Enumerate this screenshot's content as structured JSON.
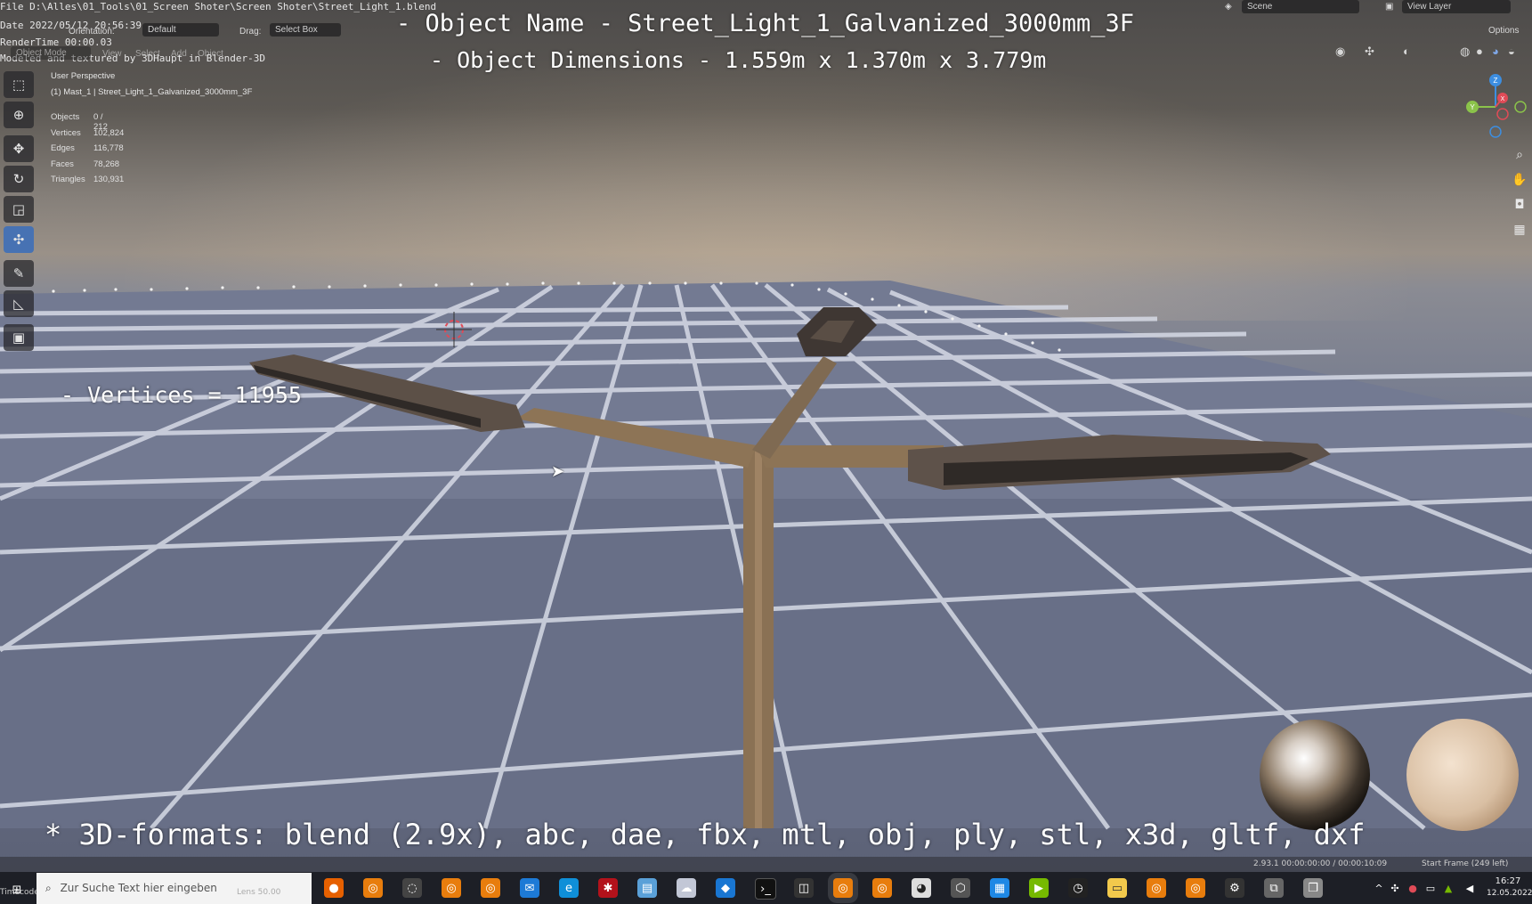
{
  "file_path": "File D:\\Alles\\01_Tools\\01_Screen Shoter\\Screen Shoter\\Street_Light_1.blend",
  "date_line": "Date 2022/05/12 20:56:39",
  "render_time": "RenderTime 00:00.03",
  "credit": "Modeled and textured by 3DHaupt in Blender-3D",
  "header": {
    "orientation_label": "Orientation:",
    "orientation_value": "Default",
    "drag_label": "Drag:",
    "drag_value": "Select Box",
    "mode_value": "Object Mode",
    "menu_view": "View",
    "menu_select": "Select",
    "menu_add": "Add",
    "menu_object": "Object",
    "scene_value": "Scene",
    "view_layer_value": "View Layer",
    "options_label": "Options"
  },
  "overlay": {
    "object_name": "- Object Name - Street_Light_1_Galvanized_3000mm_3F",
    "object_dimensions": "- Object Dimensions -  1.559m x 1.370m x 3.779m",
    "vertices_note": "- Vertices = 11955",
    "formats": "* 3D-formats: blend (2.9x), abc, dae, fbx, mtl, obj, ply, stl, x3d, gltf, dxf"
  },
  "viewport": {
    "perspective": "User Perspective",
    "collection": "(1) Mast_1 | Street_Light_1_Galvanized_3000mm_3F",
    "stats": [
      {
        "key": "Objects",
        "value": "0 / 212"
      },
      {
        "key": "Vertices",
        "value": "102,824"
      },
      {
        "key": "Edges",
        "value": "116,778"
      },
      {
        "key": "Faces",
        "value": "78,268"
      },
      {
        "key": "Triangles",
        "value": "130,931"
      }
    ],
    "gizmo": {
      "z": "Z",
      "y": "Y",
      "x": "X"
    }
  },
  "status_bar": {
    "version_time": "2.93.1  00:00:00:00 / 00:00:10:09",
    "start_frame": "Start Frame (249 left)",
    "timecode_label": "Timecode",
    "lens_label": "Lens 50.00"
  },
  "taskbar": {
    "search_placeholder": "Zur Suche Text hier eingeben",
    "clock_time": "16:27",
    "clock_date": "12.05.2022"
  },
  "colors": {
    "accent": "#4772b3",
    "gizmo_x": "#e04b57",
    "gizmo_y": "#8bc34a",
    "gizmo_z": "#3d8ee0",
    "taskbar": "#1d1f26"
  }
}
